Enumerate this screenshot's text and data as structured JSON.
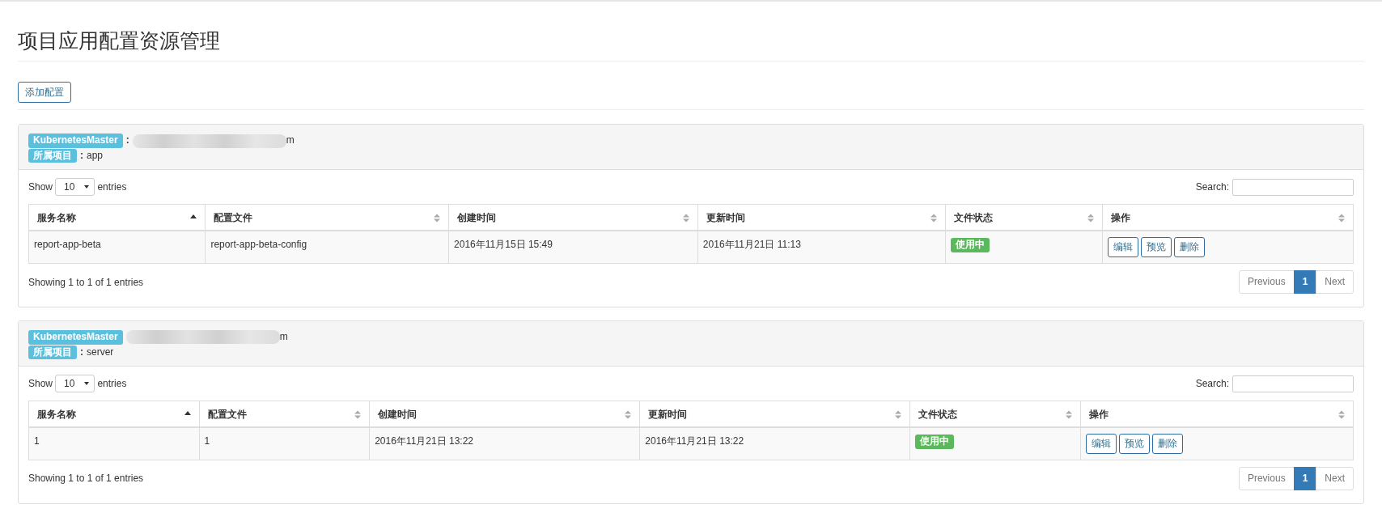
{
  "page_title": "项目应用配置资源管理",
  "add_button": "添加配置",
  "panels": [
    {
      "master_label": "KubernetesMaster",
      "master_colon": ":",
      "master_value": "m",
      "project_label": "所属项目",
      "project_colon": ":",
      "project_value": "app",
      "show_label": "Show",
      "length": "10",
      "entries_label": "entries",
      "search_label": "Search:",
      "columns": [
        {
          "label": "服务名称",
          "sorted": true
        },
        {
          "label": "配置文件",
          "sorted": false
        },
        {
          "label": "创建时间",
          "sorted": false
        },
        {
          "label": "更新时间",
          "sorted": false
        },
        {
          "label": "文件状态",
          "sorted": false
        },
        {
          "label": "操作",
          "sorted": false
        }
      ],
      "rows": [
        {
          "cells": [
            "report-app-beta",
            "report-app-beta-config",
            "2016年11月15日 15:49",
            "2016年11月21日 11:13"
          ],
          "status": {
            "text": "使用中",
            "kind": "success"
          },
          "actions": [
            "编辑",
            "预览",
            "删除"
          ]
        }
      ],
      "info": "Showing 1 to 1 of 1 entries",
      "pagination": [
        {
          "label": "Previous",
          "selected": false
        },
        {
          "label": "1",
          "selected": true
        },
        {
          "label": "Next",
          "selected": false
        }
      ]
    },
    {
      "master_label": "KubernetesMaster",
      "master_value": "m",
      "project_label": "所属项目",
      "project_colon": ":",
      "project_value": "server",
      "show_label": "Show",
      "length": "10",
      "entries_label": "entries",
      "search_label": "Search:",
      "columns": [
        {
          "label": "服务名称",
          "sorted": true
        },
        {
          "label": "配置文件",
          "sorted": false
        },
        {
          "label": "创建时间",
          "sorted": false
        },
        {
          "label": "更新时间",
          "sorted": false
        },
        {
          "label": "文件状态",
          "sorted": false
        },
        {
          "label": "操作",
          "sorted": false
        }
      ],
      "rows": [
        {
          "cells": [
            "1",
            "1",
            "2016年11月21日 13:22",
            "2016年11月21日 13:22"
          ],
          "status": {
            "text": "使用中",
            "kind": "success"
          },
          "actions": [
            "编辑",
            "预览",
            "删除"
          ]
        }
      ],
      "info": "Showing 1 to 1 of 1 entries",
      "pagination": [
        {
          "label": "Previous",
          "selected": false
        },
        {
          "label": "1",
          "selected": true
        },
        {
          "label": "Next",
          "selected": false
        }
      ]
    }
  ]
}
